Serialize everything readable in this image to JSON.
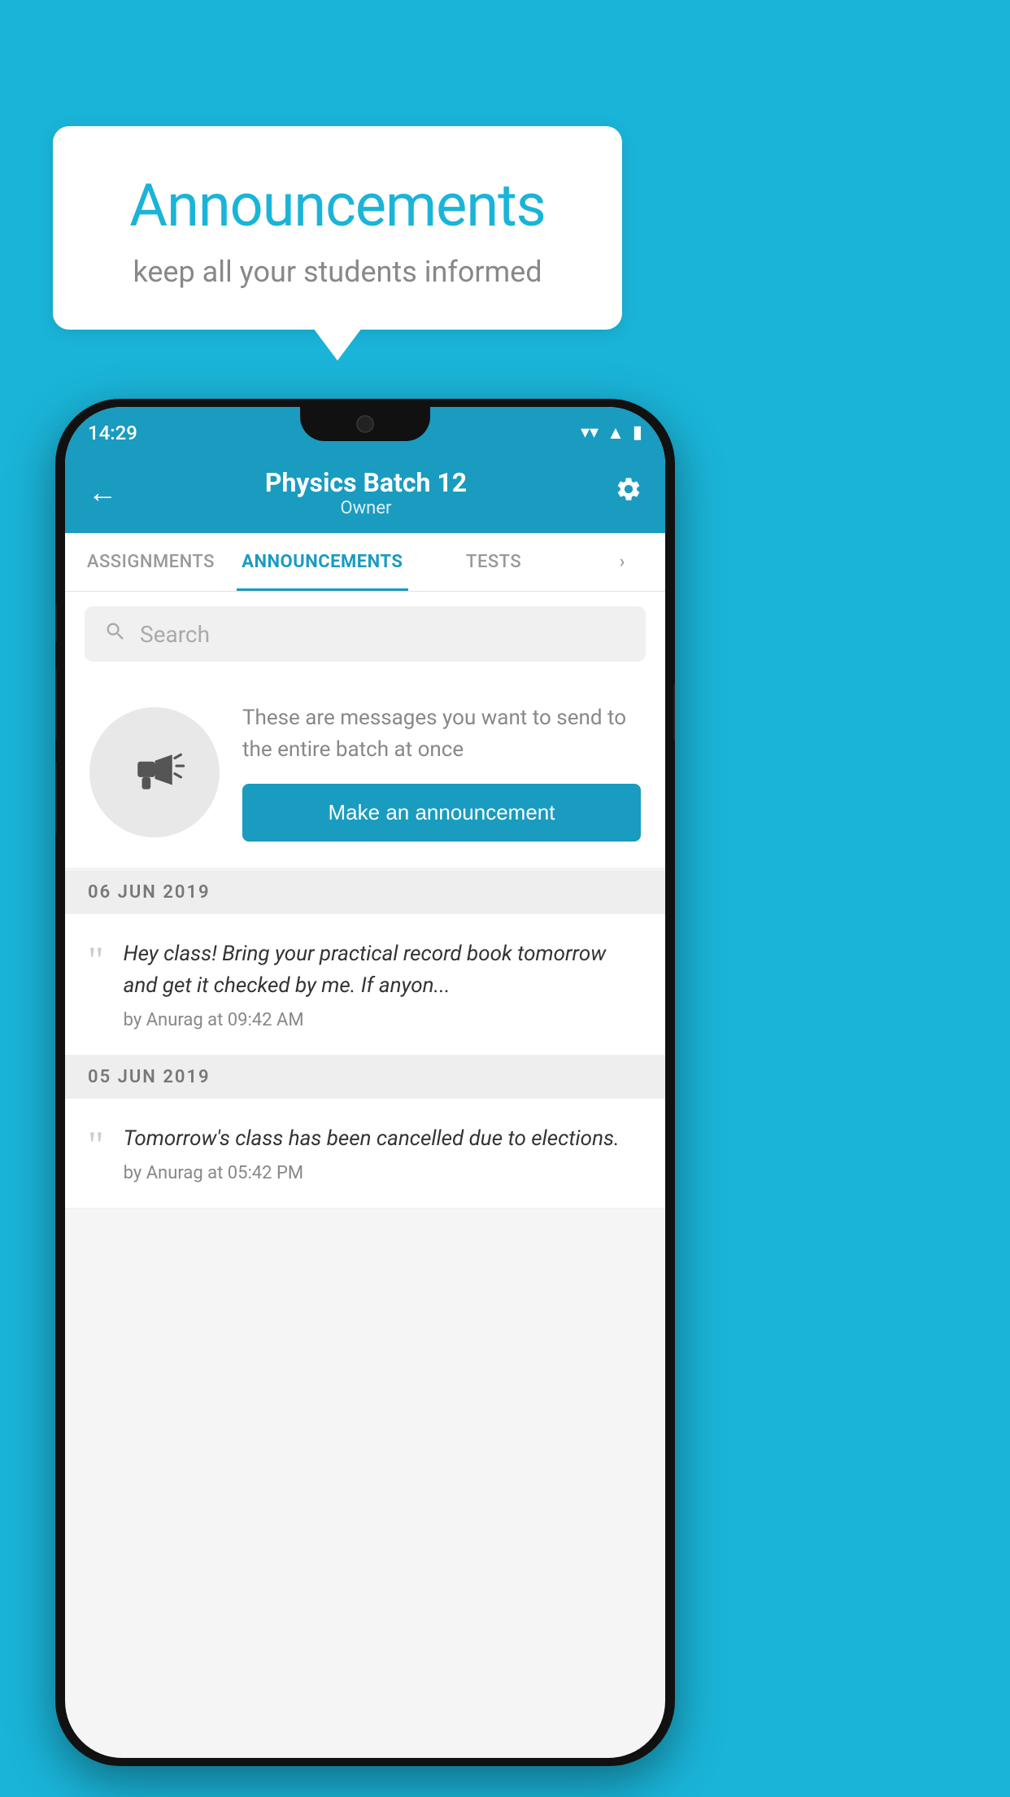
{
  "bubble": {
    "title": "Announcements",
    "subtitle": "keep all your students informed"
  },
  "phone": {
    "status": {
      "time": "14:29"
    },
    "header": {
      "title": "Physics Batch 12",
      "subtitle": "Owner",
      "back_label": "←",
      "settings_label": "⚙"
    },
    "tabs": [
      {
        "label": "ASSIGNMENTS",
        "active": false
      },
      {
        "label": "ANNOUNCEMENTS",
        "active": true
      },
      {
        "label": "TESTS",
        "active": false
      },
      {
        "label": "...",
        "active": false,
        "partial": true
      }
    ],
    "search": {
      "placeholder": "Search"
    },
    "promo": {
      "description": "These are messages you want to send to the entire batch at once",
      "button_label": "Make an announcement"
    },
    "announcements": [
      {
        "date": "06  JUN  2019",
        "text": "Hey class! Bring your practical record book tomorrow and get it checked by me. If anyon...",
        "meta": "by Anurag at 09:42 AM"
      },
      {
        "date": "05  JUN  2019",
        "text": "Tomorrow's class has been cancelled due to elections.",
        "meta": "by Anurag at 05:42 PM"
      }
    ]
  }
}
